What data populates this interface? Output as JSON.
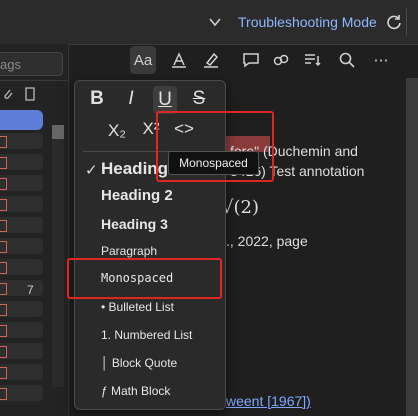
{
  "topbar": {
    "mode_label": "Troubleshooting Mode"
  },
  "sidebar": {
    "search_placeholder": "ags",
    "count": "7"
  },
  "document": {
    "line1_a": "fore\" (Duchemin and",
    "line1_b": "3416) Test annotation",
    "math": "√(2)",
    "line3": "., 2022, page",
    "link": "weent [1967])"
  },
  "menu": {
    "bold": "B",
    "italic": "I",
    "underline": "U",
    "strike": "S",
    "subscript": "X₂",
    "superscript": "X²",
    "code": "<>",
    "heading1": "Heading 1",
    "heading2": "Heading 2",
    "heading3": "Heading 3",
    "paragraph": "Paragraph",
    "monospaced": "Monospaced",
    "bulleted": "• Bulleted List",
    "numbered": "1. Numbered List",
    "blockquote": "│ Block Quote",
    "mathblock": "ƒ Math Block",
    "check": "✓"
  },
  "tooltip": {
    "text": "Monospaced"
  },
  "colors": {
    "accent": "#8fb5ff",
    "selection": "#5f7ed9",
    "annotation": "#e0271f"
  }
}
